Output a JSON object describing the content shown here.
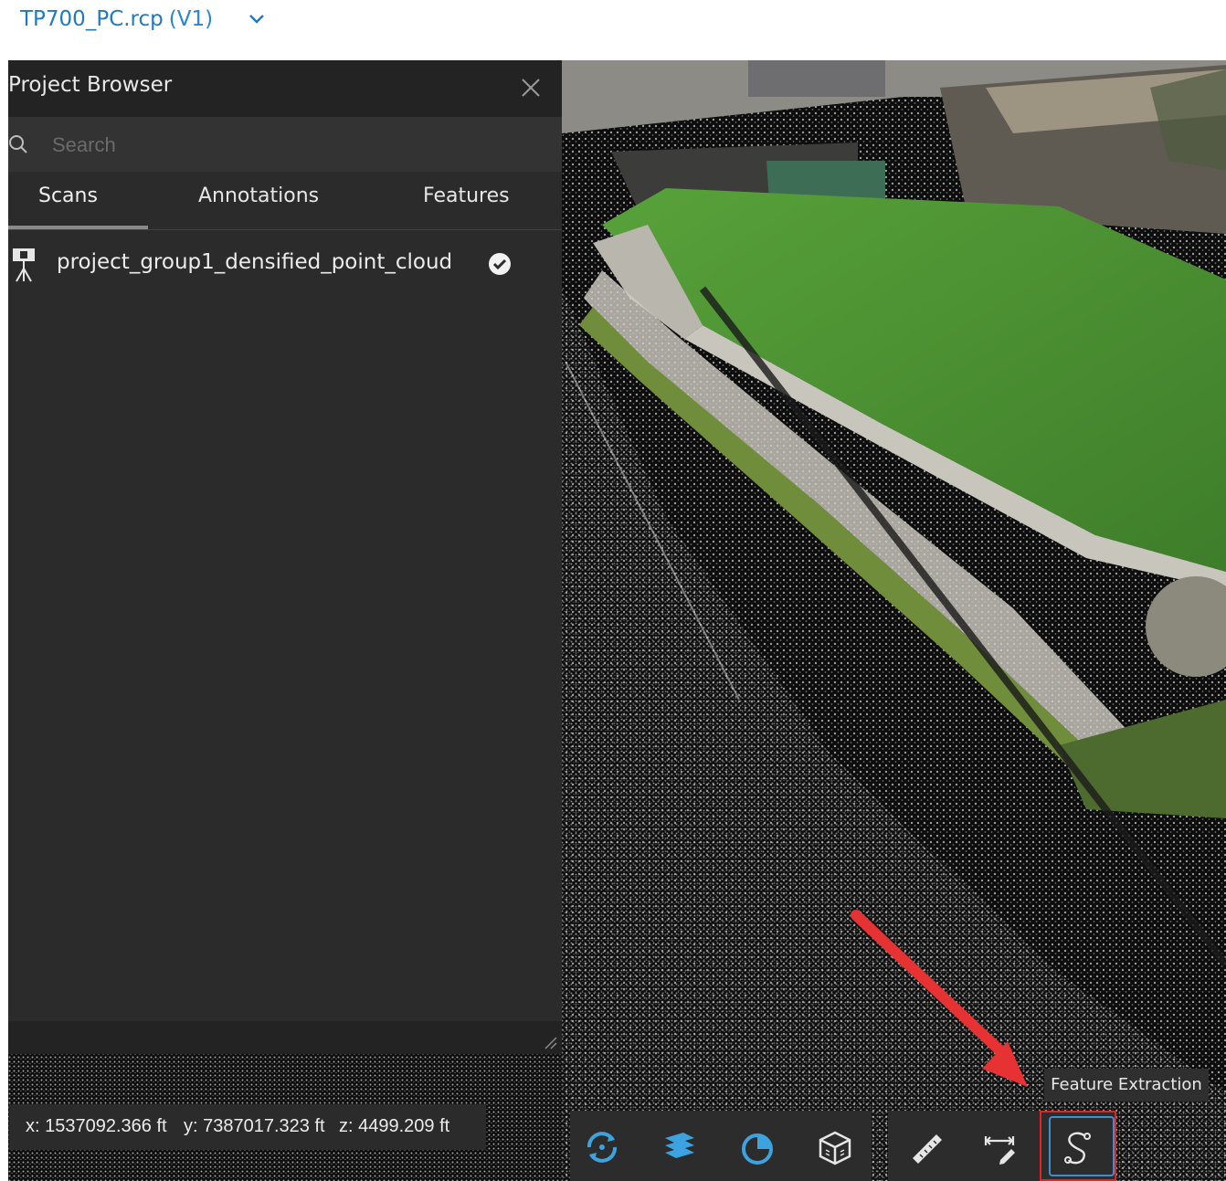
{
  "header": {
    "file_name": "TP700_PC.rcp",
    "version": "(V1)"
  },
  "browser": {
    "title": "Project Browser",
    "search_placeholder": "Search",
    "tabs": [
      "Scans",
      "Annotations",
      "Features"
    ],
    "active_tab": "Scans",
    "scans": [
      {
        "name": "project_group1_densified_point_cloud",
        "visible": true
      }
    ]
  },
  "coordinates": {
    "x": "x: 1537092.366 ft",
    "y": "y: 7387017.323 ft",
    "z": "z: 4499.209 ft"
  },
  "toolbar": {
    "tooltip": "Feature Extraction",
    "group1": [
      "orbit-icon",
      "layers-icon",
      "color-mode-icon",
      "3d-view-icon"
    ],
    "group2": [
      "ruler-icon",
      "dimension-annotate-icon",
      "feature-extraction-icon"
    ],
    "active": "feature-extraction-icon"
  },
  "colors": {
    "accent": "#1f7ac1",
    "panel": "#2b2b2b",
    "highlight": "#e02323"
  }
}
